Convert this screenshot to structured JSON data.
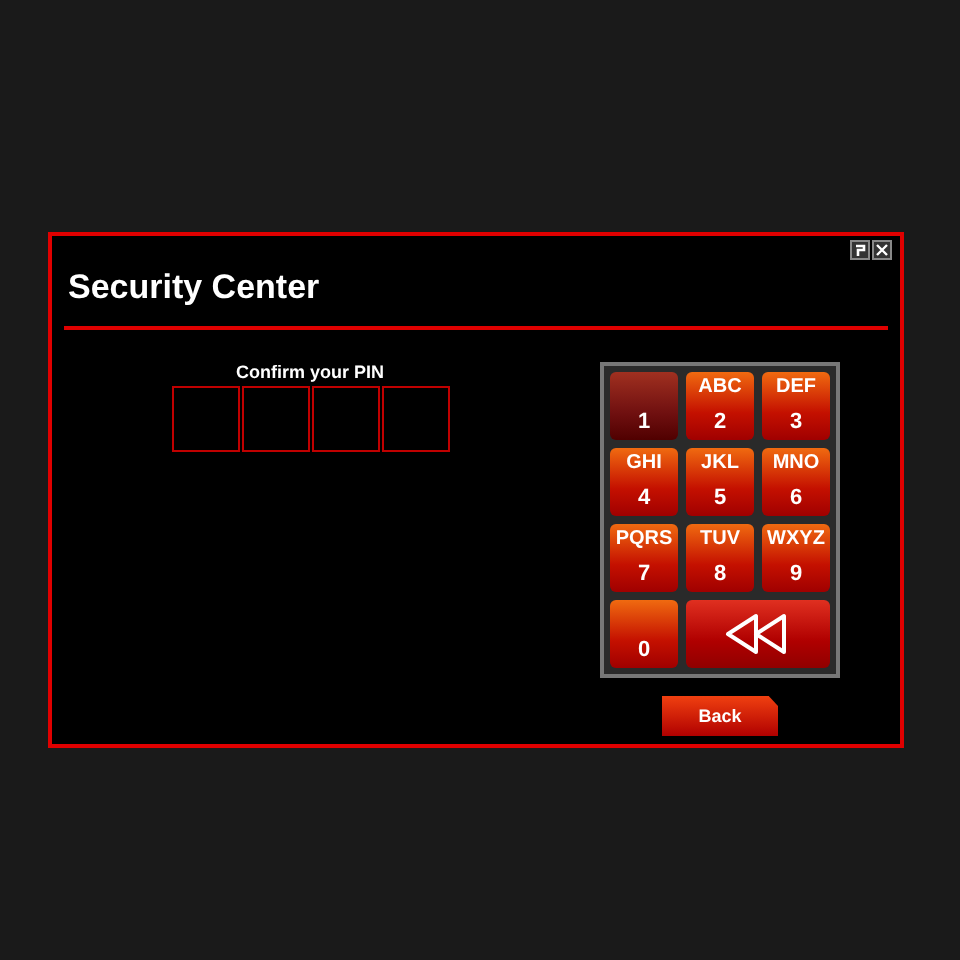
{
  "window": {
    "title": "Security Center"
  },
  "pin": {
    "label": "Confirm your PIN",
    "boxes": [
      {
        "filled": false
      },
      {
        "filled": false
      },
      {
        "filled": false
      },
      {
        "filled": false
      }
    ]
  },
  "keypad": [
    {
      "kind": "digit",
      "digit": "1",
      "pressed": true
    },
    {
      "kind": "digit",
      "letters": "ABC",
      "digit": "2",
      "pressed": false
    },
    {
      "kind": "digit",
      "letters": "DEF",
      "digit": "3",
      "pressed": false
    },
    {
      "kind": "digit",
      "letters": "GHI",
      "digit": "4",
      "pressed": false
    },
    {
      "kind": "digit",
      "letters": "JKL",
      "digit": "5",
      "pressed": false
    },
    {
      "kind": "digit",
      "letters": "MNO",
      "digit": "6",
      "pressed": false
    },
    {
      "kind": "digit",
      "letters": "PQRS",
      "digit": "7",
      "pressed": false
    },
    {
      "kind": "digit",
      "letters": "TUV",
      "digit": "8",
      "pressed": false
    },
    {
      "kind": "digit",
      "letters": "WXYZ",
      "digit": "9",
      "pressed": false
    },
    {
      "kind": "digit",
      "digit": "0",
      "pressed": false
    },
    {
      "kind": "backspace",
      "pressed": false
    }
  ],
  "buttons": [
    "Back"
  ]
}
